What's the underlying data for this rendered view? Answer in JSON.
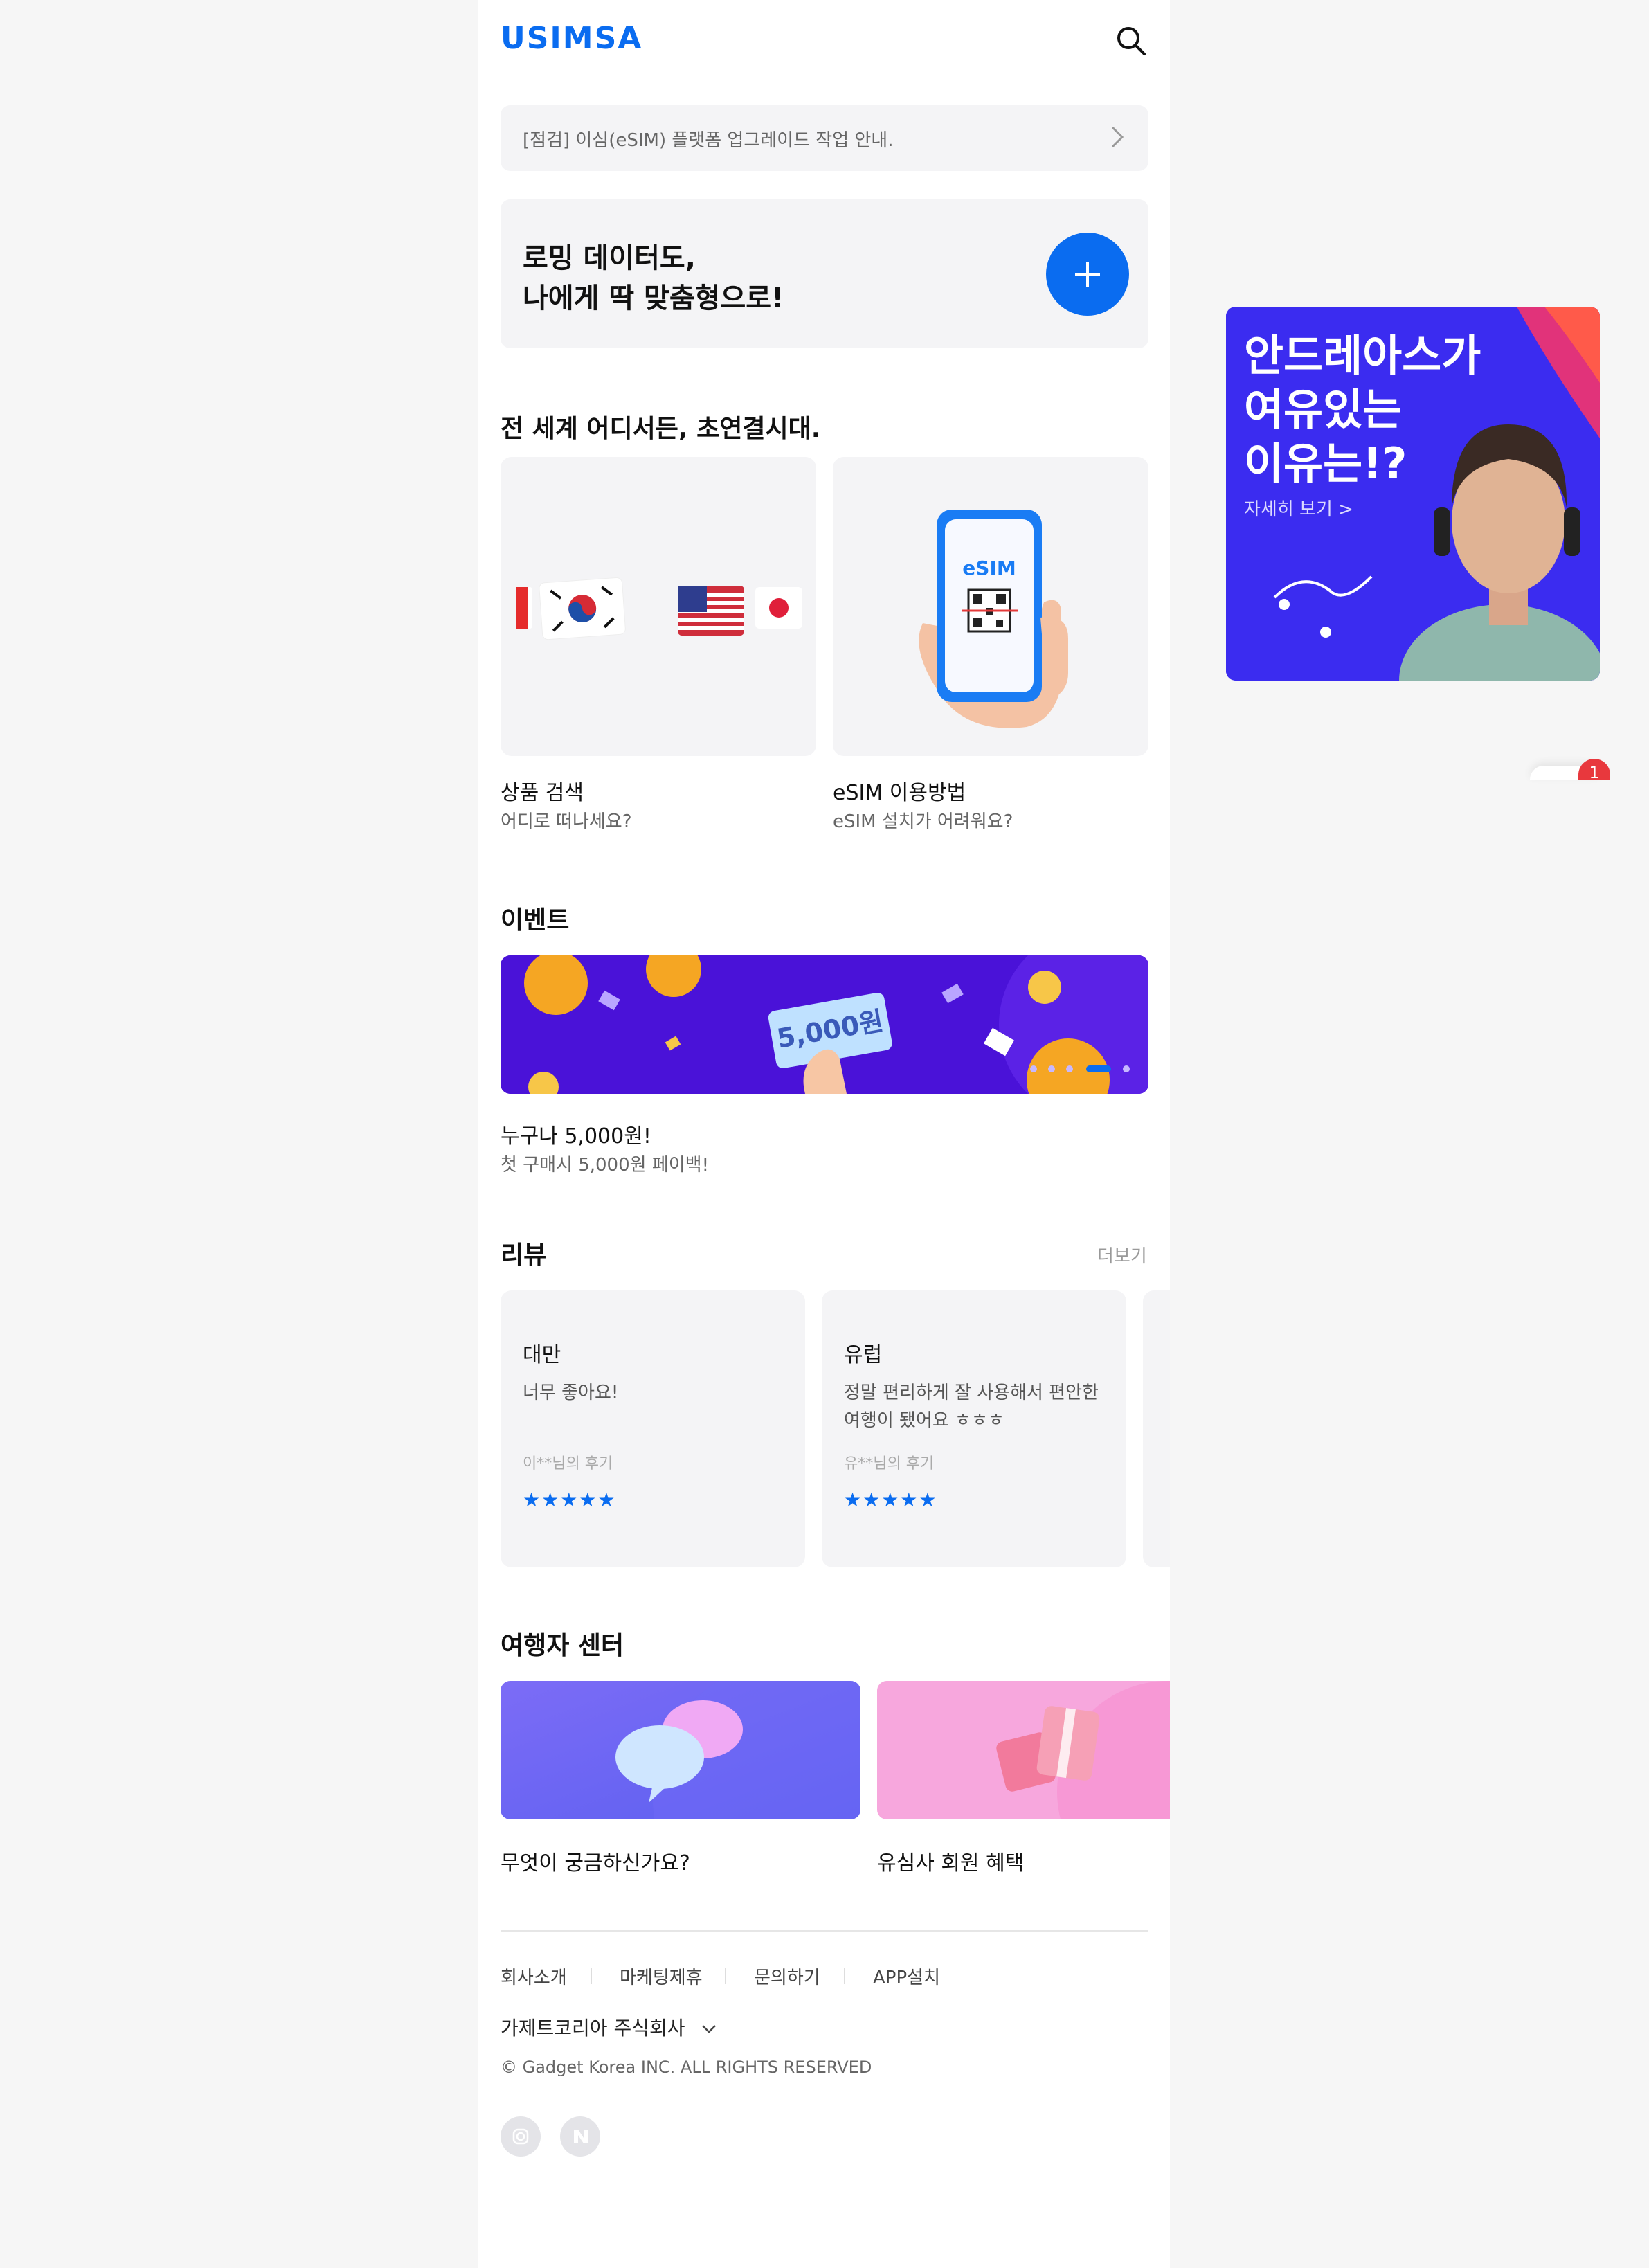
{
  "header": {
    "logo": "USIMSA",
    "search_icon": "search-icon"
  },
  "notice": {
    "text": "[점검] 이심(eSIM) 플랫폼 업그레이드 작업 안내.",
    "chevron_icon": "chevron-right-icon"
  },
  "promo": {
    "line1": "로밍 데이터도,",
    "line2": "나에게 딱 맞춤형으로!",
    "button_icon": "plus-icon"
  },
  "world": {
    "title": "전 세계 어디서든, 초연결시대.",
    "cards": [
      {
        "title": "상품 검색",
        "subtitle": "어디로 떠나세요?"
      },
      {
        "title": "eSIM 이용방법",
        "subtitle": "eSIM 설치가 어려워요?",
        "image_label": "eSIM"
      }
    ]
  },
  "event": {
    "title": "이벤트",
    "banner_text": "5,000원",
    "name": "누구나 5,000원!",
    "description": "첫 구매시 5,000원 페이백!"
  },
  "reviews": {
    "title": "리뷰",
    "more": "더보기",
    "items": [
      {
        "region": "대만",
        "text": "너무 좋아요!",
        "author": "이**님의 후기",
        "rating": 5
      },
      {
        "region": "유럽",
        "text": "정말 편리하게 잘 사용해서 편안한 여행이 됐어요 ㅎㅎㅎ",
        "author": "유**님의 후기",
        "rating": 5
      }
    ],
    "star_color": "#0a6cf0"
  },
  "traveler_center": {
    "title": "여행자 센터",
    "cards": [
      {
        "label": "무엇이 궁금하신가요?"
      },
      {
        "label": "유심사 회원 혜택"
      }
    ]
  },
  "footer": {
    "links": [
      "회사소개",
      "마케팅제휴",
      "문의하기",
      "APP설치"
    ],
    "company": "가제트코리아 주식회사",
    "copyright": "© Gadget Korea INC. ALL RIGHTS RESERVED",
    "social_icons": [
      "instagram-icon",
      "naver-icon"
    ]
  },
  "side_ad": {
    "line1": "안드레아스가",
    "line2": "여유있는",
    "line3": "이유는!?",
    "more": "자세히 보기 >"
  },
  "floating_badge": {
    "count": "1"
  },
  "colors": {
    "brand": "#0a6cf0",
    "event_bg": "#4a12d8",
    "ad_bg": "#3b2cf0"
  }
}
